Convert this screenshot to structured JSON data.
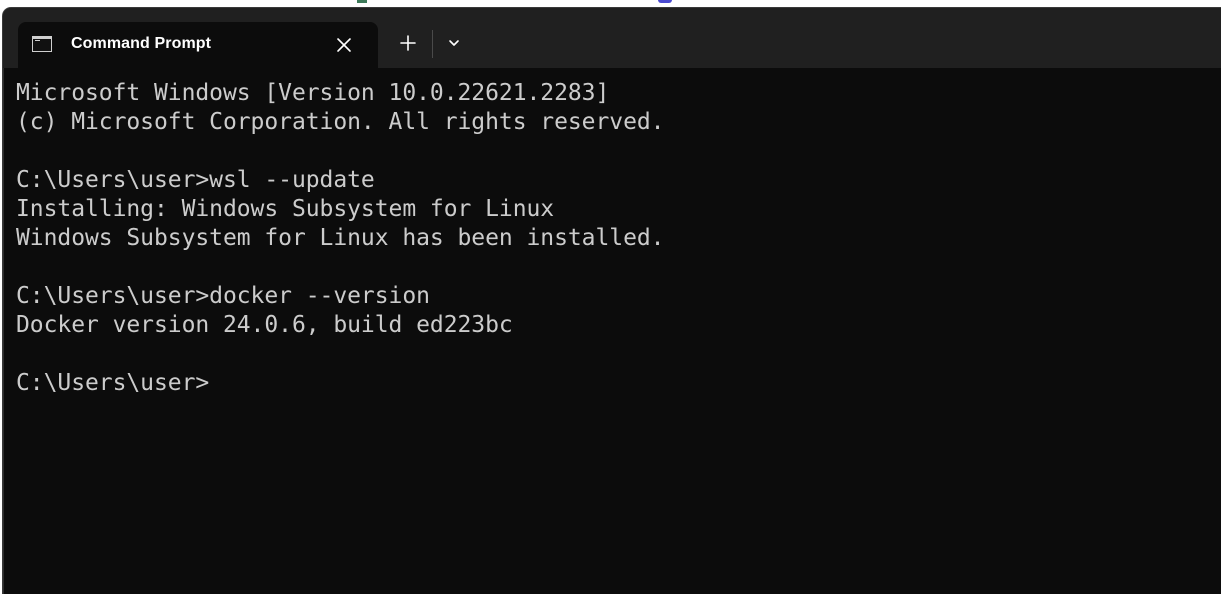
{
  "tab": {
    "title": "Command Prompt",
    "icon": "terminal-icon",
    "close_icon": "close-icon"
  },
  "toolbar": {
    "new_tab_icon": "plus-icon",
    "dropdown_icon": "chevron-down-icon"
  },
  "terminal": {
    "lines": [
      "Microsoft Windows [Version 10.0.22621.2283]",
      "(c) Microsoft Corporation. All rights reserved.",
      "",
      "C:\\Users\\user>wsl --update",
      "Installing: Windows Subsystem for Linux",
      "Windows Subsystem for Linux has been installed.",
      "",
      "C:\\Users\\user>docker --version",
      "Docker version 24.0.6, build ed223bc",
      "",
      "C:\\Users\\user>"
    ]
  },
  "colors": {
    "terminal_background": "#0c0c0c",
    "terminal_text": "#cccccc",
    "titlebar_background": "#202020"
  }
}
